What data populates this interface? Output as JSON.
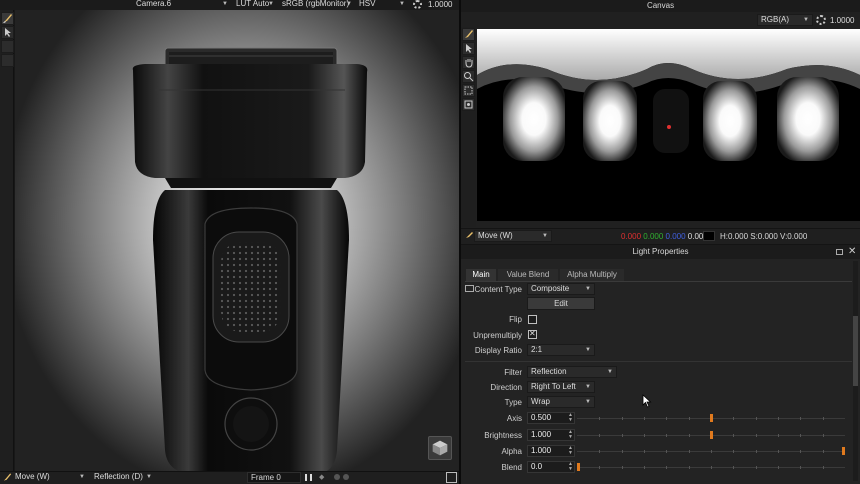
{
  "viewport": {
    "camera": "Camera.6",
    "lut": "LUT Auto",
    "colorspace": "sRGB (rgbMonitor)",
    "color_mode": "HSV",
    "exposure": "1.0000",
    "bottom_bar": {
      "tool": "Move (W)",
      "mode": "Reflection (D)",
      "frame": "Frame 0"
    }
  },
  "canvas": {
    "title": "Canvas",
    "channel": "RGB(A)",
    "exposure": "1.0000",
    "tool": "Move (W)",
    "pixel_r": "0.000",
    "pixel_g": "0.000",
    "pixel_b": "0.000",
    "pixel_a": "0.000",
    "hsv": "H:0.000 S:0.000 V:0.000",
    "colors": {
      "r": "#e03030",
      "g": "#30b030",
      "b": "#4060e0"
    }
  },
  "light_properties": {
    "title": "Light Properties",
    "tabs": [
      "Main",
      "Value Blend",
      "Alpha Multiply"
    ],
    "content_type_label": "Content Type",
    "content_type": "Composite",
    "edit_label": "Edit",
    "flip_label": "Flip",
    "flip_checked": false,
    "unpremultiply_label": "Unpremultiply",
    "unpremultiply_checked": true,
    "display_ratio_label": "Display Ratio",
    "display_ratio": "2:1",
    "filter_label": "Filter",
    "filter": "Reflection",
    "direction_label": "Direction",
    "direction": "Right To Left",
    "type_label": "Type",
    "type": "Wrap",
    "axis_label": "Axis",
    "axis": "0.500",
    "axis_level": 0.5,
    "brightness_label": "Brightness",
    "brightness": "1.000",
    "brightness_level": 0.5,
    "alpha_label": "Alpha",
    "alpha": "1.000",
    "alpha_level": 1.0,
    "blend_label": "Blend",
    "blend": "0.0",
    "blend_level": 0.0
  },
  "colors": {
    "accent": "#e07a1e",
    "panel_bg": "#232323",
    "header_bg": "#1b1b1b"
  }
}
